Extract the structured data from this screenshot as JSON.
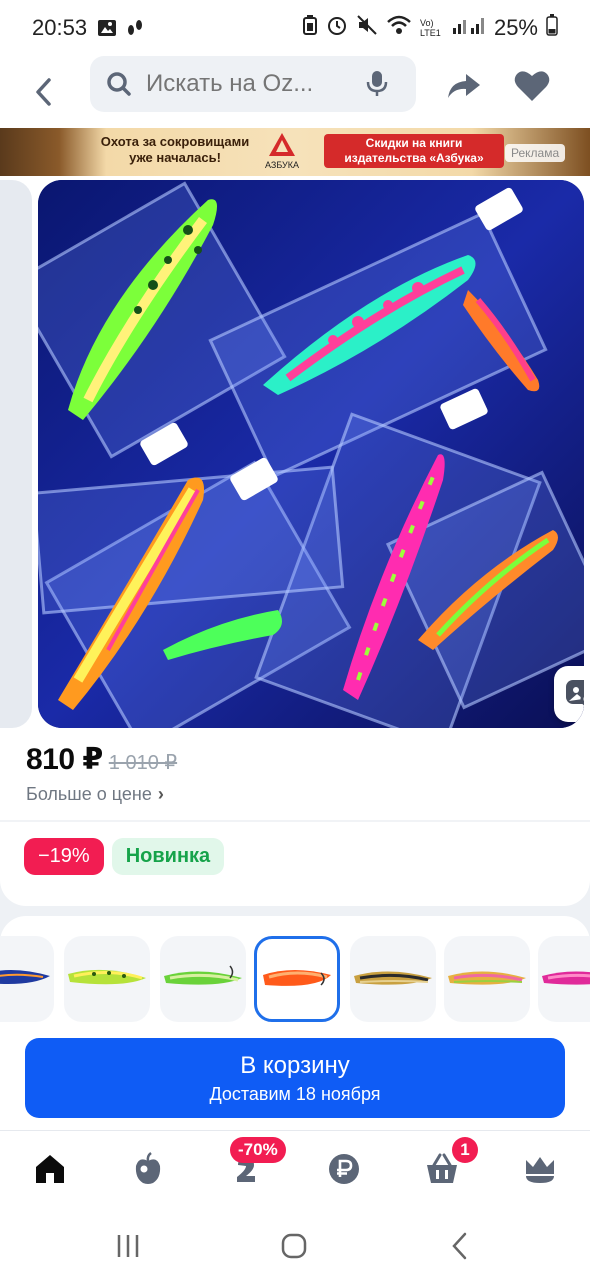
{
  "status_bar": {
    "time": "20:53",
    "network_label": "Vo) LTE1",
    "battery": "25%"
  },
  "header": {
    "search_placeholder": "Искать на Oz..."
  },
  "ad_banner": {
    "left_text": "Охота за сокровищами уже началась!",
    "logo_text": "АЗБУКА",
    "cta_text": "Скидки на книги издательства «Азбука»",
    "ad_label": "Реклама"
  },
  "product": {
    "price": "810 ₽",
    "old_price": "1 010 ₽",
    "price_more": "Больше о цене",
    "badges": {
      "discount": "−19%",
      "new": "Новинка"
    },
    "variants_selected_index": 3
  },
  "cart_button": {
    "title": "В корзину",
    "subtitle": "Доставим 18 ноября"
  },
  "bottom_nav": {
    "promo_badge": "-70%",
    "cart_count": "1"
  },
  "colors": {
    "accent_blue": "#0f5cf5",
    "discount_pink": "#f21d52",
    "new_green": "#16a34a"
  }
}
